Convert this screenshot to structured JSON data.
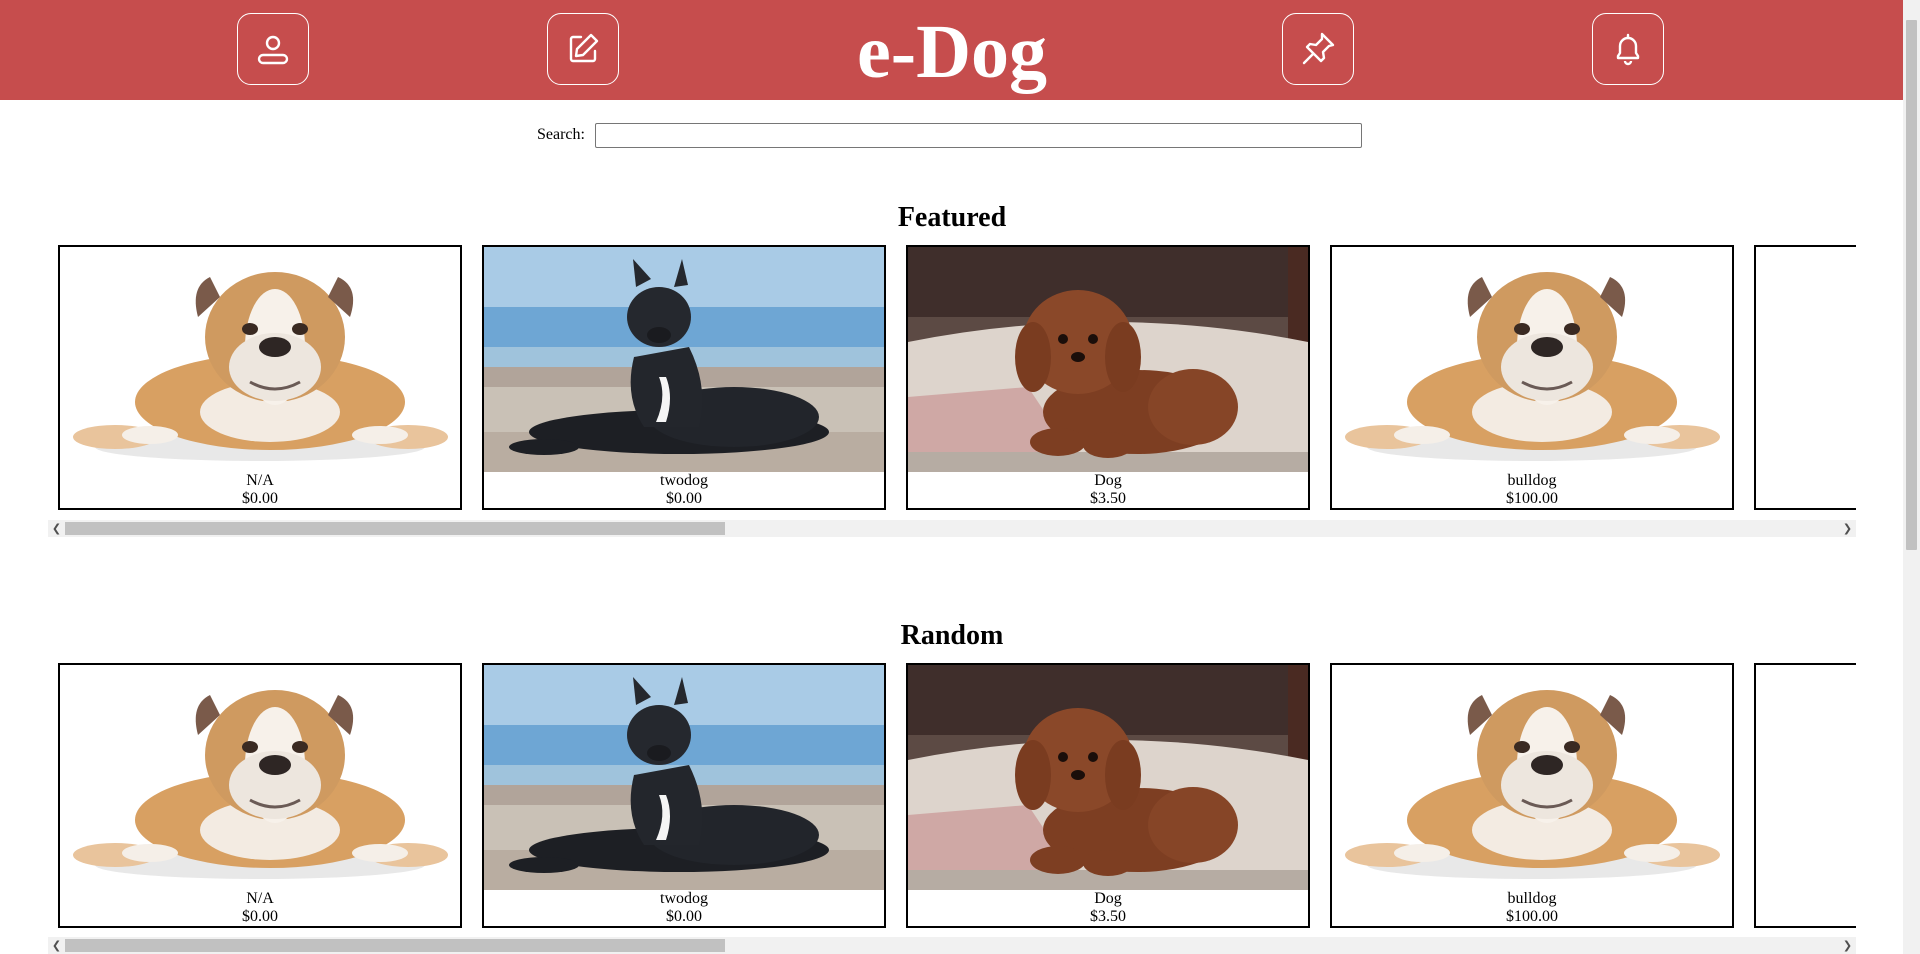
{
  "header": {
    "title": "e-Dog",
    "background_color": "#c64d4d",
    "icons": [
      "profile-icon",
      "edit-icon",
      "pin-icon",
      "bell-icon"
    ]
  },
  "search": {
    "label": "Search:",
    "value": "",
    "placeholder": ""
  },
  "sections": [
    {
      "title": "Featured",
      "items": [
        {
          "name": "N/A",
          "price": "$0.00",
          "image": "bulldog"
        },
        {
          "name": "twodog",
          "price": "$0.00",
          "image": "black-dog-beach"
        },
        {
          "name": "Dog",
          "price": "$3.50",
          "image": "poodle"
        },
        {
          "name": "bulldog",
          "price": "$100.00",
          "image": "bulldog"
        }
      ]
    },
    {
      "title": "Random",
      "items": [
        {
          "name": "N/A",
          "price": "$0.00",
          "image": "bulldog"
        },
        {
          "name": "twodog",
          "price": "$0.00",
          "image": "black-dog-beach"
        },
        {
          "name": "Dog",
          "price": "$3.50",
          "image": "poodle"
        },
        {
          "name": "bulldog",
          "price": "$100.00",
          "image": "bulldog"
        }
      ]
    }
  ]
}
